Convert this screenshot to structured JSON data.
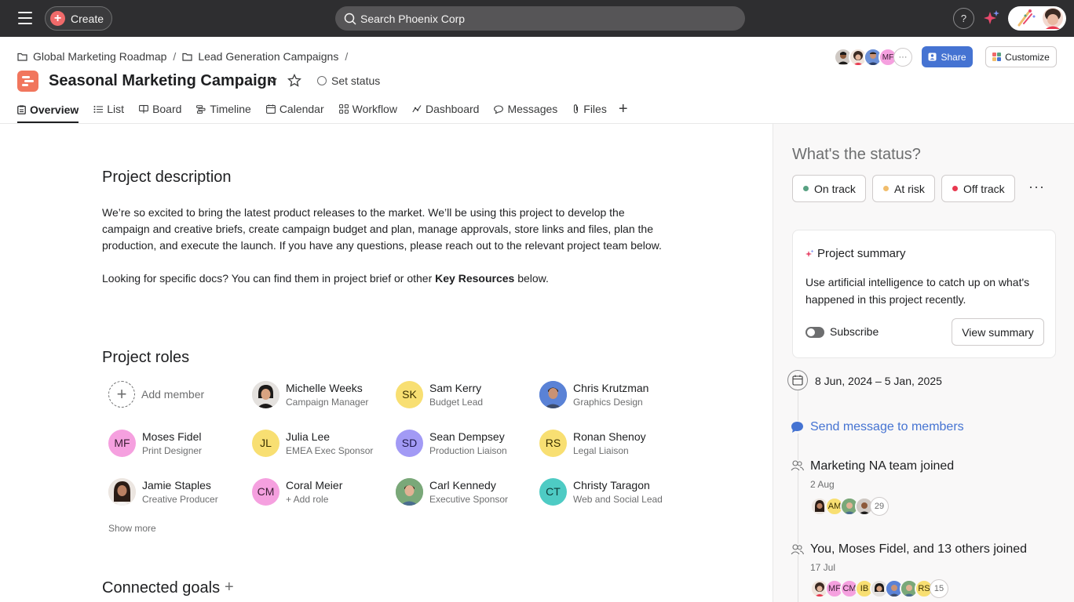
{
  "topbar": {
    "create_label": "Create",
    "search_placeholder": "Search Phoenix Corp",
    "help_label": "?"
  },
  "breadcrumb": [
    "Global Marketing Roadmap",
    "Lead Generation Campaigns"
  ],
  "breadcrumb_sep": "/",
  "project": {
    "title": "Seasonal Marketing Campaign",
    "set_status": "Set status",
    "icon_color": "#f1765d"
  },
  "header_members": {
    "initials_mf": "MF",
    "more": "···"
  },
  "share_label": "Share",
  "customize_label": "Customize",
  "tabs": [
    {
      "label": "Overview",
      "icon": "overview-icon"
    },
    {
      "label": "List",
      "icon": "list-icon"
    },
    {
      "label": "Board",
      "icon": "board-icon"
    },
    {
      "label": "Timeline",
      "icon": "timeline-icon"
    },
    {
      "label": "Calendar",
      "icon": "calendar-icon"
    },
    {
      "label": "Workflow",
      "icon": "workflow-icon"
    },
    {
      "label": "Dashboard",
      "icon": "dashboard-icon"
    },
    {
      "label": "Messages",
      "icon": "messages-icon"
    },
    {
      "label": "Files",
      "icon": "files-icon"
    }
  ],
  "tab_add": "+",
  "description": {
    "title": "Project description",
    "p1": "We’re so excited to bring the latest product releases to the market. We’ll be using this project to develop the campaign and creative briefs, create campaign budget and plan, manage approvals, store links and files, plan the production, and execute the launch. If you have any questions, please reach out to the relevant project team below.",
    "p2_before": "Looking for specific docs? You can find them in project brief or other ",
    "p2_bold": "Key Resources",
    "p2_after": " below."
  },
  "roles": {
    "title": "Project roles",
    "add_member": "Add member",
    "add_plus": "+",
    "show_more": "Show more",
    "members": [
      {
        "name": "Michelle Weeks",
        "role": "Campaign Manager",
        "initials": ""
      },
      {
        "name": "Sam Kerry",
        "role": "Budget Lead",
        "initials": "SK"
      },
      {
        "name": "Chris Krutzman",
        "role": "Graphics Design",
        "initials": ""
      },
      {
        "name": "Moses Fidel",
        "role": "Print Designer",
        "initials": "MF"
      },
      {
        "name": "Julia Lee",
        "role": "EMEA Exec Sponsor",
        "initials": "JL"
      },
      {
        "name": "Sean Dempsey",
        "role": "Production Liaison",
        "initials": "SD"
      },
      {
        "name": "Ronan Shenoy",
        "role": "Legal Liaison",
        "initials": "RS"
      },
      {
        "name": "Jamie Staples",
        "role": "Creative Producer",
        "initials": ""
      },
      {
        "name": "Coral Meier",
        "role": "+ Add role",
        "initials": "CM"
      },
      {
        "name": "Carl Kennedy",
        "role": "Executive Sponsor",
        "initials": ""
      },
      {
        "name": "Christy Taragon",
        "role": "Web and Social Lead",
        "initials": "CT"
      }
    ]
  },
  "goals": {
    "title": "Connected goals",
    "add": "+"
  },
  "status_panel": {
    "question": "What's the status?",
    "buttons": [
      {
        "label": "On track",
        "color": "#58a182"
      },
      {
        "label": "At risk",
        "color": "#f1bd6c"
      },
      {
        "label": "Off track",
        "color": "#e8384f"
      }
    ],
    "more": "···"
  },
  "summary": {
    "title": "Project summary",
    "description": "Use artificial intelligence to catch up on what's happened in this project recently.",
    "subscribe_label": "Subscribe",
    "view_label": "View summary"
  },
  "timeline": {
    "date_range": "8 Jun, 2024 – 5 Jan, 2025",
    "send_message": "Send message to members",
    "events": [
      {
        "title": "Marketing NA team joined",
        "date": "2 Aug",
        "am": "AM",
        "count": "29"
      },
      {
        "title": "You, Moses Fidel, and 13 others joined",
        "date": "17 Jul",
        "mf": "MF",
        "cm": "CM",
        "ib": "IB",
        "rs": "RS",
        "count": "15"
      }
    ]
  },
  "colors": {
    "accent": "#4573d2",
    "topbar": "#2e2e30",
    "create": "#f06a6a"
  }
}
